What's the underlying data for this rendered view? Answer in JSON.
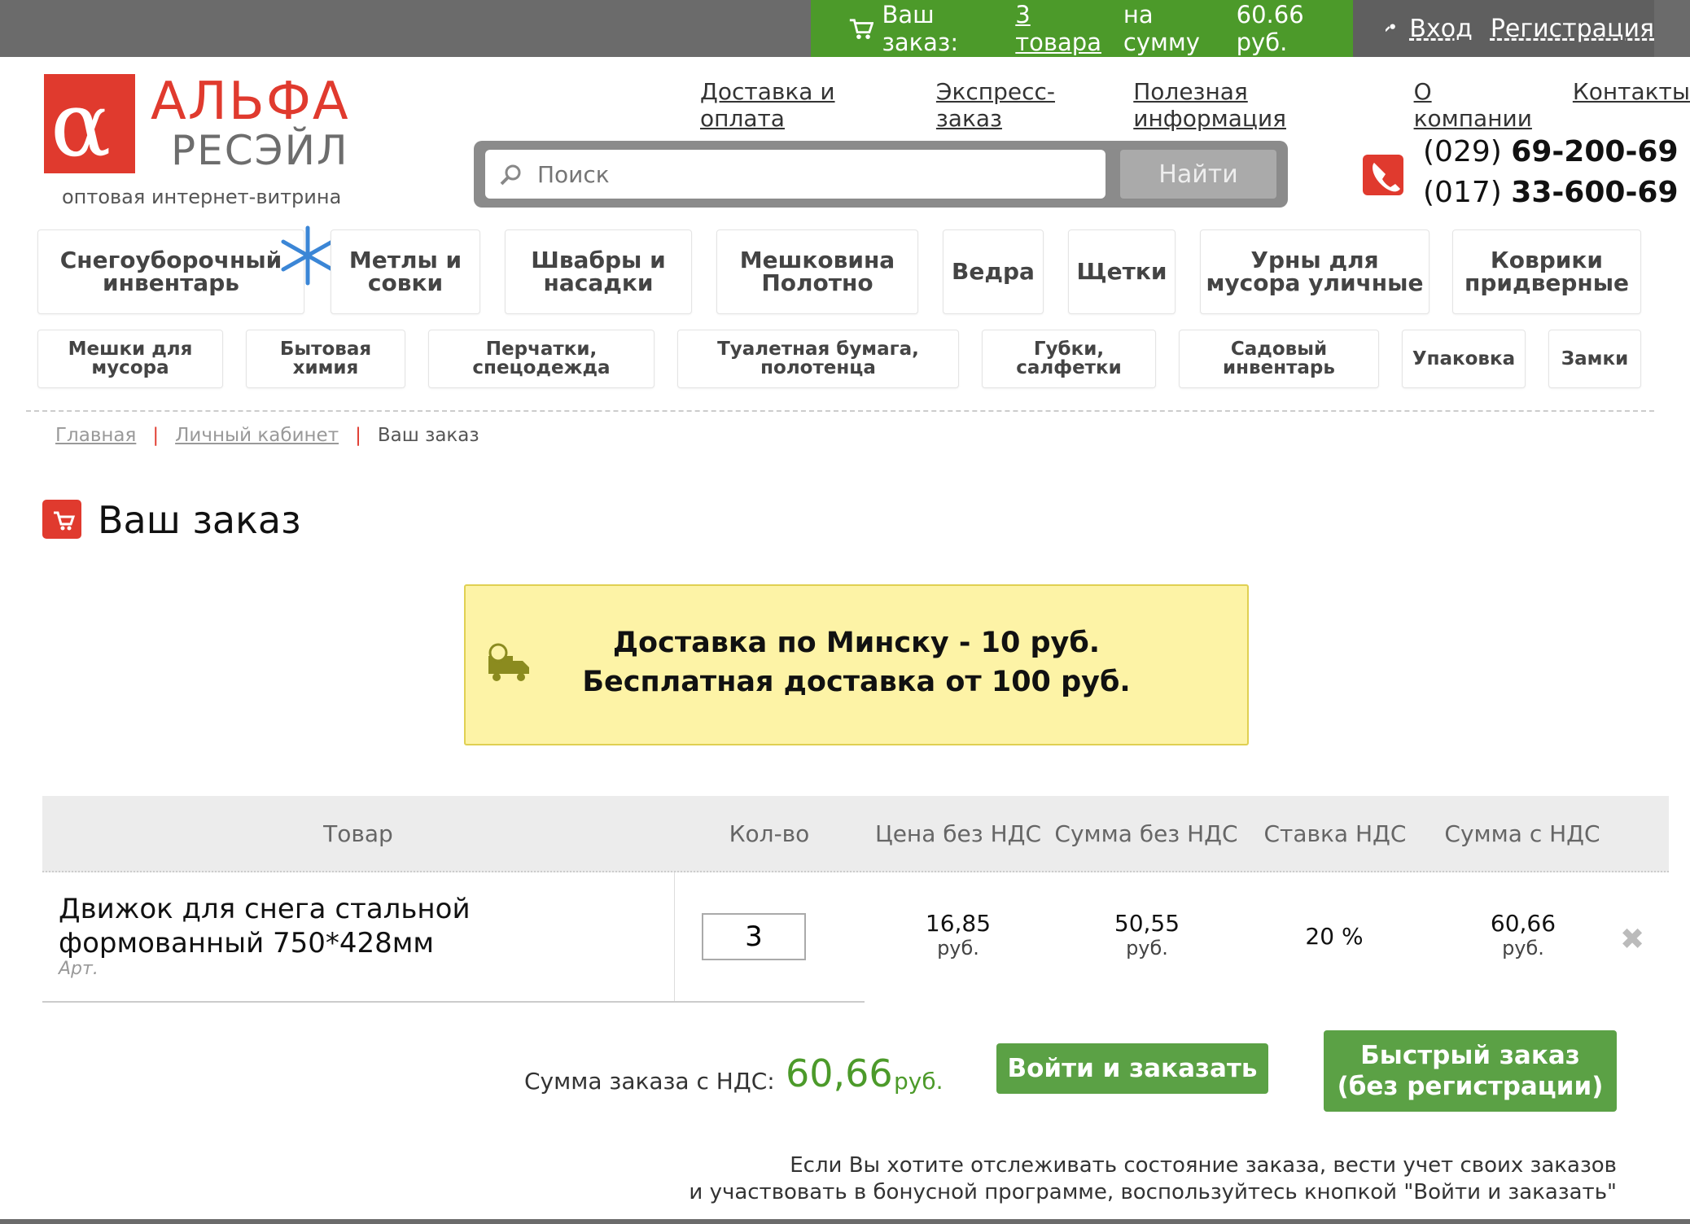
{
  "cart": {
    "prefix": "Ваш заказ:",
    "count": "3 товара",
    "middle": "на сумму",
    "sum": "60.66 руб."
  },
  "auth": {
    "login": "Вход",
    "register": "Регистрация"
  },
  "logo": {
    "line1": "АЛЬФА",
    "line2": "РЕСЭЙЛ",
    "tagline": "оптовая интернет-витрина"
  },
  "nav": [
    "Доставка и оплата",
    "Экспресс-заказ",
    "Полезная информация",
    "О компании",
    "Контакты"
  ],
  "search": {
    "placeholder": "Поиск",
    "button": "Найти"
  },
  "phones": [
    {
      "code": "(029)",
      "number": "69-200-69"
    },
    {
      "code": "(017)",
      "number": "33-600-69"
    }
  ],
  "categories_row1": [
    "Снегоуборочный инвентарь",
    "Метлы и совки",
    "Швабры и насадки",
    "Мешковина Полотно",
    "Ведра",
    "Щетки",
    "Урны для мусора уличные",
    "Коврики придверные"
  ],
  "categories_row2": [
    "Мешки для мусора",
    "Бытовая химия",
    "Перчатки, спецодежда",
    "Туалетная бумага, полотенца",
    "Губки, салфетки",
    "Садовый инвентарь",
    "Упаковка",
    "Замки"
  ],
  "breadcrumb": {
    "home": "Главная",
    "cabinet": "Личный кабинет",
    "current": "Ваш заказ",
    "sep": "|"
  },
  "page_title": "Ваш заказ",
  "notice": {
    "line1": "Доставка по Минску - 10 руб.",
    "line2": "Бесплатная доставка от 100 руб."
  },
  "table": {
    "headers": {
      "product": "Товар",
      "qty": "Кол-во",
      "price": "Цена без НДС",
      "sum": "Сумма без НДС",
      "vat_rate": "Ставка НДС",
      "sum_vat": "Сумма с НДС"
    },
    "row": {
      "name": "Движок для снега стальной формованный 750*428мм",
      "art": "Арт.",
      "qty": "3",
      "price": "16,85",
      "sum": "50,55",
      "vat_rate": "20 %",
      "sum_vat": "60,66",
      "unit": "руб."
    }
  },
  "total": {
    "label": "Сумма заказа с НДС:",
    "value": "60,66",
    "unit": "руб."
  },
  "buttons": {
    "login_order": "Войти и заказать",
    "quick_order_1": "Быстрый заказ",
    "quick_order_2": "(без регистрации)"
  },
  "note": {
    "line1": "Если Вы хотите отслеживать состояние заказа, вести учет своих заказов",
    "line2": "и участвовать в бонусной программе, воспользуйтесь кнопкой \"Войти и заказать\""
  },
  "colors": {
    "brand_red": "#e03a2e",
    "green": "#4c9a2a",
    "notice_bg": "#fdf3a6"
  }
}
